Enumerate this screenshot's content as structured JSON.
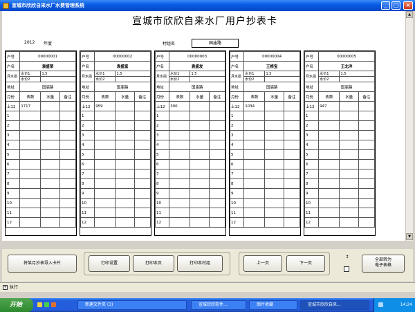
{
  "window": {
    "title": "宣城市欣欣自来水厂水费管理系统"
  },
  "form": {
    "title": "宣城市欣欣自来水厂用户抄表卡",
    "year": "2012",
    "year_label": "年度",
    "village_label": "村组名",
    "village": "国庙路"
  },
  "labels": {
    "account": "户号",
    "name": "户名",
    "meter_type": "月水损",
    "price1": "水价1",
    "price2": "水价2",
    "address": "地址",
    "month": "月份",
    "reading": "表数",
    "volume": "水量",
    "remark": "备注",
    "prev": "上12"
  },
  "cards": [
    {
      "account": "00000001",
      "name": "袁盛荣",
      "price1": "1.5",
      "address": "国庙路",
      "prev_reading": "1717"
    },
    {
      "account": "00000002",
      "name": "袁盛富",
      "price1": "1.5",
      "address": "国庙路",
      "prev_reading": "959"
    },
    {
      "account": "00000003",
      "name": "袁盛发",
      "price1": "1.5",
      "address": "国庙路",
      "prev_reading": "300"
    },
    {
      "account": "00000004",
      "name": "王根宝",
      "price1": "1.5",
      "address": "国庙路",
      "prev_reading": "1034"
    },
    {
      "account": "00000005",
      "name": "王北洋",
      "price1": "1.5",
      "address": "国庙路",
      "prev_reading": "947"
    }
  ],
  "months": [
    "1",
    "2",
    "3",
    "4",
    "5",
    "6",
    "7",
    "8",
    "9",
    "10",
    "11",
    "12"
  ],
  "buttons": {
    "import": "将某月抄表导入卡片",
    "print_setup": "打印设置",
    "print_page": "打印本页",
    "print_group": "打印本村组",
    "prev_page": "上一页",
    "next_page": "下一页",
    "export_line1": "全部转为",
    "export_line2": "电子表格"
  },
  "status": {
    "expander": "+",
    "label": "执行"
  },
  "taskbar": {
    "start": "开始",
    "tasks": [
      "新建文件夹 (3)",
      "宣城欣欣软件...",
      "图片收藏",
      "宣城市欣欣自来..."
    ],
    "clock": "14:24"
  },
  "colors": {
    "titlebar": "#0a5de4",
    "taskbar": "#245edc",
    "start": "#2e8a2e"
  }
}
